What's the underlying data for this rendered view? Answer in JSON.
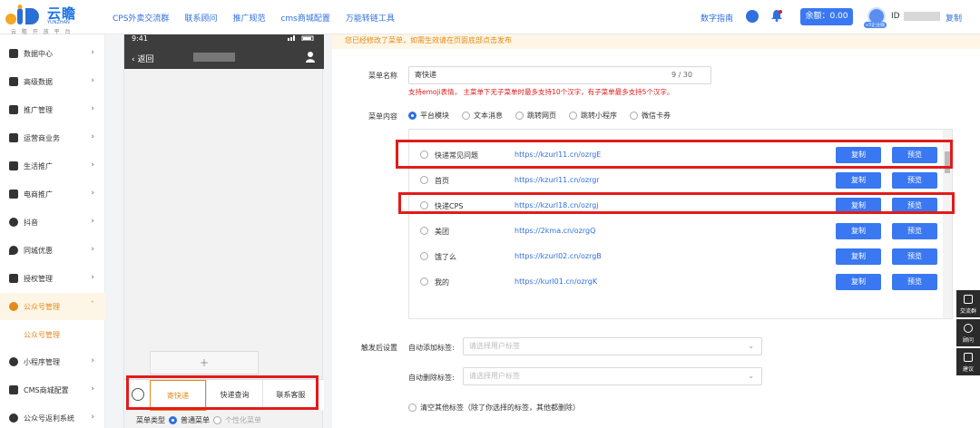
{
  "header": {
    "brand": "云瞻",
    "brand_sub": "YUNZHAN",
    "slogan": "云 瞻 开 放 平 台",
    "nav": [
      "CPS外卖交流群",
      "联系顾问",
      "推广规范",
      "cms商城配置",
      "万能转链工具"
    ],
    "doc_link": "数字指南",
    "balance_label": "余额：0.00",
    "id_label": "ID",
    "copy_label": "复制",
    "avatar_badge": "v3企业版"
  },
  "sidebar": {
    "items": [
      {
        "label": "数据中心",
        "icon": "chart-icon"
      },
      {
        "label": "高级数据",
        "icon": "layers-icon"
      },
      {
        "label": "推广管理",
        "icon": "grid-icon"
      },
      {
        "label": "运营商业务",
        "icon": "card-icon"
      },
      {
        "label": "生活推广",
        "icon": "calendar-icon"
      },
      {
        "label": "电商推广",
        "icon": "shop-icon"
      },
      {
        "label": "抖音",
        "icon": "tiktok-icon"
      },
      {
        "label": "同城优惠",
        "icon": "location-icon"
      },
      {
        "label": "授权管理",
        "icon": "key-icon"
      },
      {
        "label": "公众号管理",
        "icon": "wechat-icon",
        "active": true
      },
      {
        "label": "小程序管理",
        "icon": "user-icon"
      },
      {
        "label": "CMS商城配置",
        "icon": "cms-icon"
      },
      {
        "label": "公众号返利系统",
        "icon": "wechat-rebate-icon"
      }
    ],
    "sub_active": "公众号管理"
  },
  "phone": {
    "time": "9:41",
    "back_label": "返回",
    "plus_label": "+",
    "menu_tabs": [
      "寄快递",
      "快递查询",
      "联系客服"
    ],
    "menu_type_label": "菜单类型",
    "menu_type_options": [
      "普通菜单",
      "个性化菜单"
    ]
  },
  "form": {
    "warning": "您已经修改了菜单，如需生效请在页面底部点击发布",
    "name_label": "菜单名称",
    "name_value": "寄快递",
    "name_count": "9 / 30",
    "name_hint": "支持emoji表情，  主菜单下无子菜单时最多支持10个汉字，有子菜单最多支持5个汉字。",
    "content_label": "菜单内容",
    "content_options": [
      "平台模块",
      "文本消息",
      "跳转网页",
      "跳转小程序",
      "微信卡券"
    ],
    "rows": [
      {
        "name": "快递常见问题",
        "url": "https://kzurl11.cn/ozrgE"
      },
      {
        "name": "首页",
        "url": "https://kzurl11.cn/ozrgr"
      },
      {
        "name": "快递CPS",
        "url": "https://kzurl18.cn/ozrgj"
      },
      {
        "name": "美团",
        "url": "https://2kma.cn/ozrgQ"
      },
      {
        "name": "饿了么",
        "url": "https://kzurl02.cn/ozrgB"
      },
      {
        "name": "我的",
        "url": "https://kurl01.cn/ozrgK"
      }
    ],
    "copy_btn": "复制",
    "preview_btn": "预览",
    "after_label": "触发后设置",
    "auto_add_label": "自动添加标签:",
    "auto_del_label": "自动删除标签:",
    "tag_placeholder": "请选择用户标签",
    "clear_label": "清空其他标签（除了你选择的标签，其他都删除）"
  },
  "float_tools": [
    "交流群",
    "顾问",
    "建议"
  ],
  "colors": {
    "accent": "#3a78f2",
    "orange": "#e4891a",
    "red_box": "#e21b1b"
  }
}
